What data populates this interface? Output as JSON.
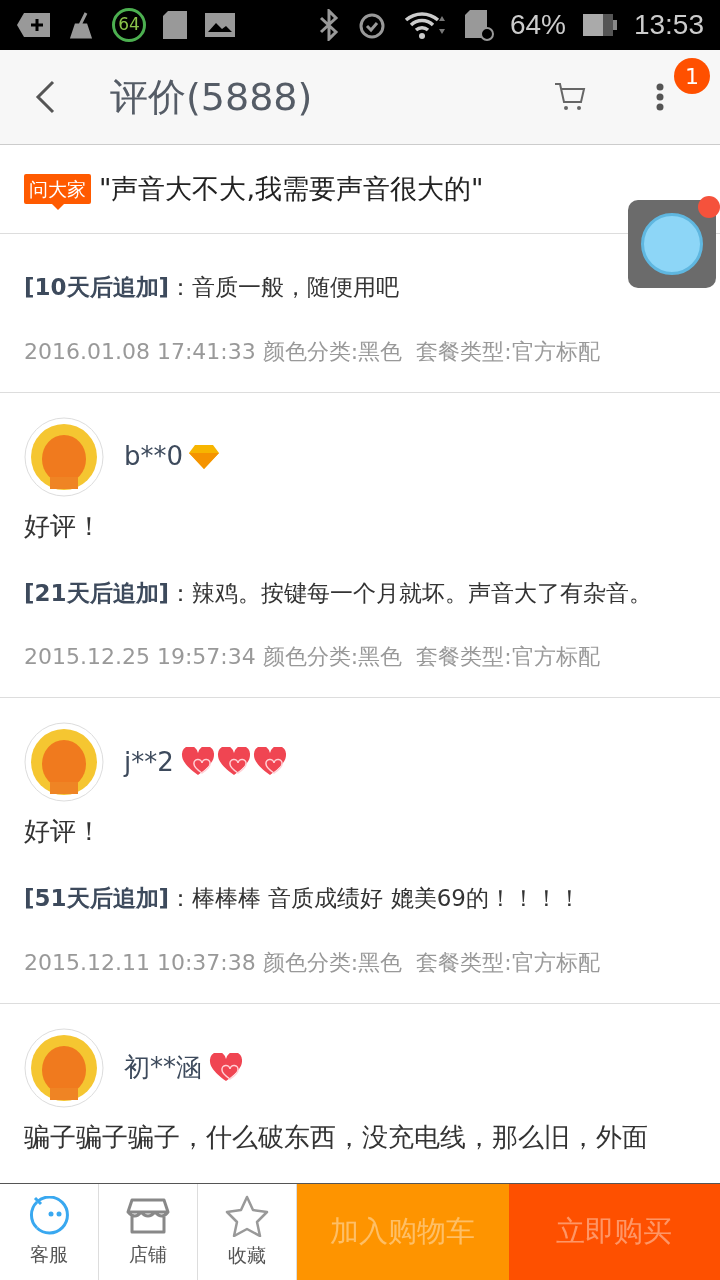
{
  "status_bar": {
    "badge": "64",
    "battery": "64%",
    "time": "13:53"
  },
  "header": {
    "title": "评价(5888)",
    "notification_count": "1"
  },
  "question": {
    "tag": "问大家",
    "text": "\"声音大不大,我需要声音很大的\""
  },
  "reviews": [
    {
      "append_label": "[10天后追加]",
      "append_text": "：音质一般，随便用吧",
      "meta": "2016.01.08 17:41:33 颜色分类:黑色  套餐类型:官方标配"
    },
    {
      "user": "b**0",
      "badges": [
        {
          "kind": "diamond"
        }
      ],
      "text": "好评！",
      "append_label": "[21天后追加]",
      "append_text": "：辣鸡。按键每一个月就坏。声音大了有杂音。",
      "meta": "2015.12.25 19:57:34 颜色分类:黑色  套餐类型:官方标配"
    },
    {
      "user": "j**2",
      "badges": [
        {
          "kind": "heart"
        },
        {
          "kind": "heart"
        },
        {
          "kind": "heart"
        }
      ],
      "text": "好评！",
      "append_label": "[51天后追加]",
      "append_text": "：棒棒棒 音质成绩好 媲美69的！！！！",
      "meta": "2015.12.11 10:37:38 颜色分类:黑色  套餐类型:官方标配"
    },
    {
      "user": "初**涵",
      "badges": [
        {
          "kind": "heart"
        }
      ],
      "text": "骗子骗子骗子，什么破东西，没充电线，那么旧，外面"
    }
  ],
  "bottom_bar": {
    "icons": [
      {
        "kind": "service",
        "label": "客服"
      },
      {
        "kind": "shop",
        "label": "店铺"
      },
      {
        "kind": "favorite",
        "label": "收藏"
      }
    ],
    "buttons": [
      {
        "label": "加入购物车",
        "color": "#fe9400",
        "disabled": true
      },
      {
        "label": "立即购买",
        "color": "#fe5000",
        "disabled": true
      }
    ]
  }
}
